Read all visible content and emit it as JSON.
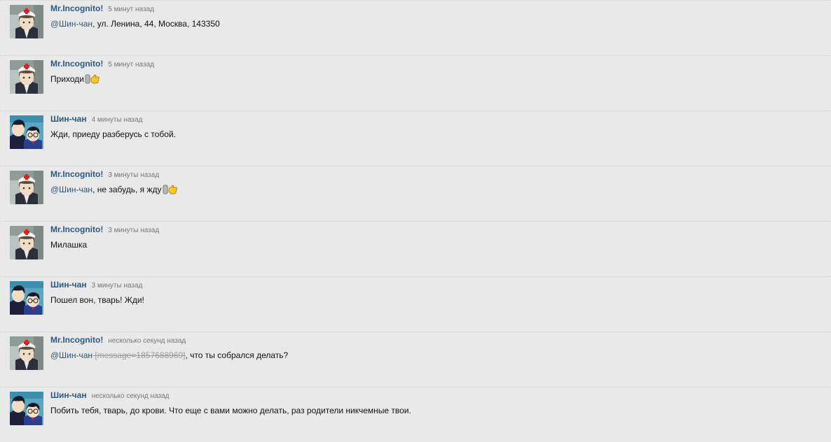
{
  "messages": [
    {
      "author": "Mr.Incognito!",
      "avatar": "nurse-avatar-icon",
      "time": "5 минут назад",
      "mention": "@Шин-чан",
      "strike": "",
      "text": ", ул. Ленина, 44, Москва, 143350",
      "emoji": false
    },
    {
      "author": "Mr.Incognito!",
      "avatar": "nurse-avatar-icon",
      "time": "5 минут назад",
      "mention": "",
      "strike": "",
      "text": "Приходи",
      "emoji": true
    },
    {
      "author": "Шин-чан",
      "avatar": "conan-avatar-icon",
      "time": "4 минуты назад",
      "mention": "",
      "strike": "",
      "text": "Жди, приеду разберусь с тобой.",
      "emoji": false
    },
    {
      "author": "Mr.Incognito!",
      "avatar": "nurse-avatar-icon",
      "time": "3 минуты назад",
      "mention": "@Шин-чан",
      "strike": "",
      "text": ", не забудь, я жду",
      "emoji": true
    },
    {
      "author": "Mr.Incognito!",
      "avatar": "nurse-avatar-icon",
      "time": "3 минуты назад",
      "mention": "",
      "strike": "",
      "text": "Милашка",
      "emoji": false
    },
    {
      "author": "Шин-чан",
      "avatar": "conan-avatar-icon",
      "time": "3 минуты назад",
      "mention": "",
      "strike": "",
      "text": "Пошел вон, тварь! Жди!",
      "emoji": false
    },
    {
      "author": "Mr.Incognito!",
      "avatar": "nurse-avatar-icon",
      "time": "несколько секунд назад",
      "mention": "@Шин-чан",
      "strike": " [message=1857688969]",
      "text": ", что ты собрался делать?",
      "emoji": false
    },
    {
      "author": "Шин-чан",
      "avatar": "conan-avatar-icon",
      "time": "несколько секунд назад",
      "mention": "",
      "strike": "",
      "text": "Побить тебя, тварь, до крови. Что еще с вами можно делать, раз родители никчемные твои.",
      "emoji": false
    }
  ],
  "colors": {
    "background": "#e9e9e9",
    "link": "#2a5885",
    "time": "#777777",
    "strike": "#9a9a9a"
  }
}
